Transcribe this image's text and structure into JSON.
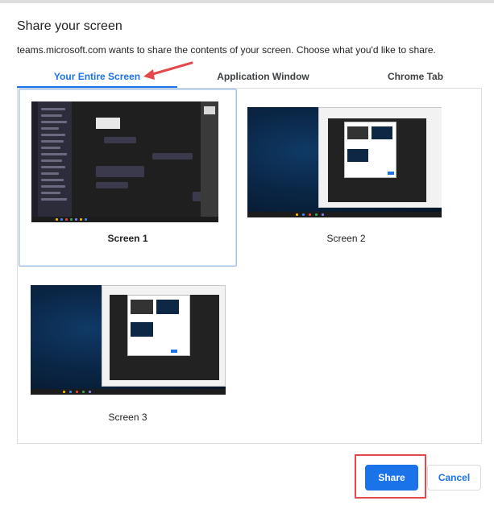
{
  "dialog": {
    "title": "Share your screen",
    "description": "teams.microsoft.com wants to share the contents of your screen. Choose what you'd like to share."
  },
  "tabs": [
    {
      "label": "Your Entire Screen",
      "active": true
    },
    {
      "label": "Application Window",
      "active": false
    },
    {
      "label": "Chrome Tab",
      "active": false
    }
  ],
  "screens": [
    {
      "label": "Screen 1",
      "selected": true
    },
    {
      "label": "Screen 2",
      "selected": false
    },
    {
      "label": "Screen 3",
      "selected": false
    }
  ],
  "footer": {
    "share_label": "Share",
    "cancel_label": "Cancel"
  },
  "colors": {
    "accent": "#1a73e8",
    "annotation_red": "#e5484d",
    "selection_border": "#9ec0e6"
  },
  "icons": {
    "annotation": "red-arrow-icon"
  }
}
